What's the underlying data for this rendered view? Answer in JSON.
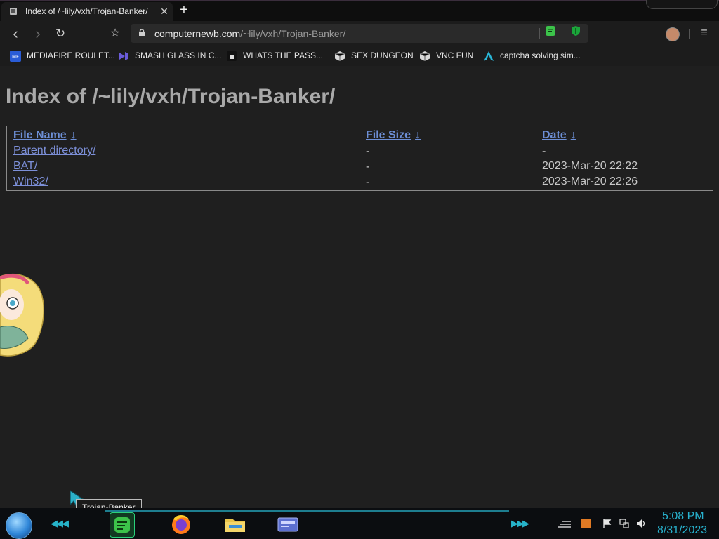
{
  "browser": {
    "tab": {
      "title": "Index of /~lily/vxh/Trojan-Banker/",
      "close_glyph": "✕"
    },
    "new_tab_glyph": "+",
    "url": {
      "host": "computernewb.com",
      "path": "/~lily/vxh/Trojan-Banker/"
    },
    "nav": {
      "back": "‹",
      "forward": "›",
      "reload": "↻",
      "bookmark": "☆",
      "menu": "≡"
    }
  },
  "bookmarks": [
    {
      "label": "MEDIAFIRE ROULET...",
      "icon": "mediafire-icon"
    },
    {
      "label": "SMASH GLASS IN C...",
      "icon": "visual-studio-icon"
    },
    {
      "label": "WHATS THE PASS...",
      "icon": "lock-box-icon"
    },
    {
      "label": "SEX DUNGEON",
      "icon": "cube-icon"
    },
    {
      "label": "VNC FUN",
      "icon": "cube-icon"
    },
    {
      "label": "captcha solving sim...",
      "icon": "arch-icon"
    }
  ],
  "page": {
    "title": "Index of /~lily/vxh/Trojan-Banker/",
    "headers": {
      "name": "File Name",
      "size": "File Size",
      "date": "Date",
      "sort_arrow": "↓"
    },
    "rows": [
      {
        "name": "Parent directory/",
        "size": "-",
        "date": "-"
      },
      {
        "name": "BAT/",
        "size": "-",
        "date": "2023-Mar-20 22:22"
      },
      {
        "name": "Win32/",
        "size": "-",
        "date": "2023-Mar-20 22:26"
      }
    ]
  },
  "taskbar": {
    "tooltip": "Trojan-Banker",
    "apps": [
      "messaging-app-icon",
      "firefox-icon",
      "file-explorer-icon",
      "id-card-app-icon"
    ],
    "clock": {
      "time": "5:08 PM",
      "date": "8/31/2023"
    },
    "accent": "#28b3cf"
  }
}
